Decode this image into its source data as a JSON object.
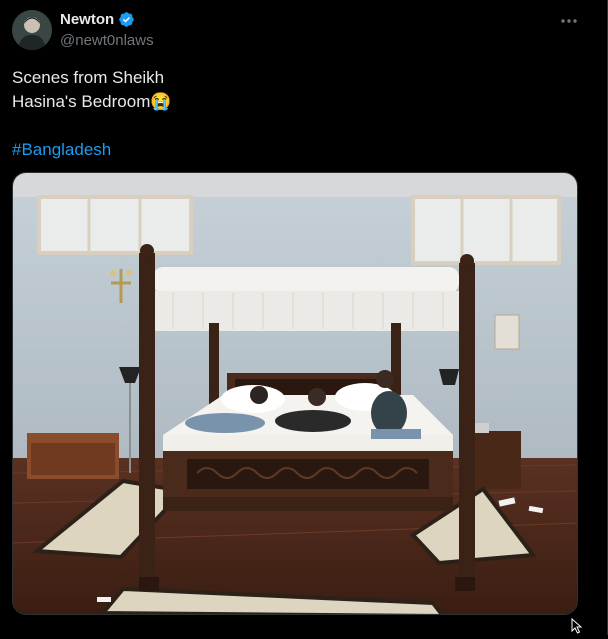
{
  "tweet": {
    "author": {
      "display_name": "Newton",
      "handle": "@newt0nlaws",
      "verified_icon": "verified-badge-icon",
      "avatar_icon": "avatar"
    },
    "more_icon": "more-horizontal-icon",
    "text_lines": [
      "Scenes from Sheikh",
      "Hasina's Bedroom"
    ],
    "emoji": "😭",
    "hashtag": "#Bangladesh",
    "media": {
      "type": "photo",
      "icon": "photo-bedroom-four-poster-bed"
    }
  },
  "colors": {
    "background": "#000000",
    "text": "#e7e9ea",
    "secondary_text": "#71767b",
    "link": "#1d9bf0",
    "verified": "#1d9bf0"
  }
}
